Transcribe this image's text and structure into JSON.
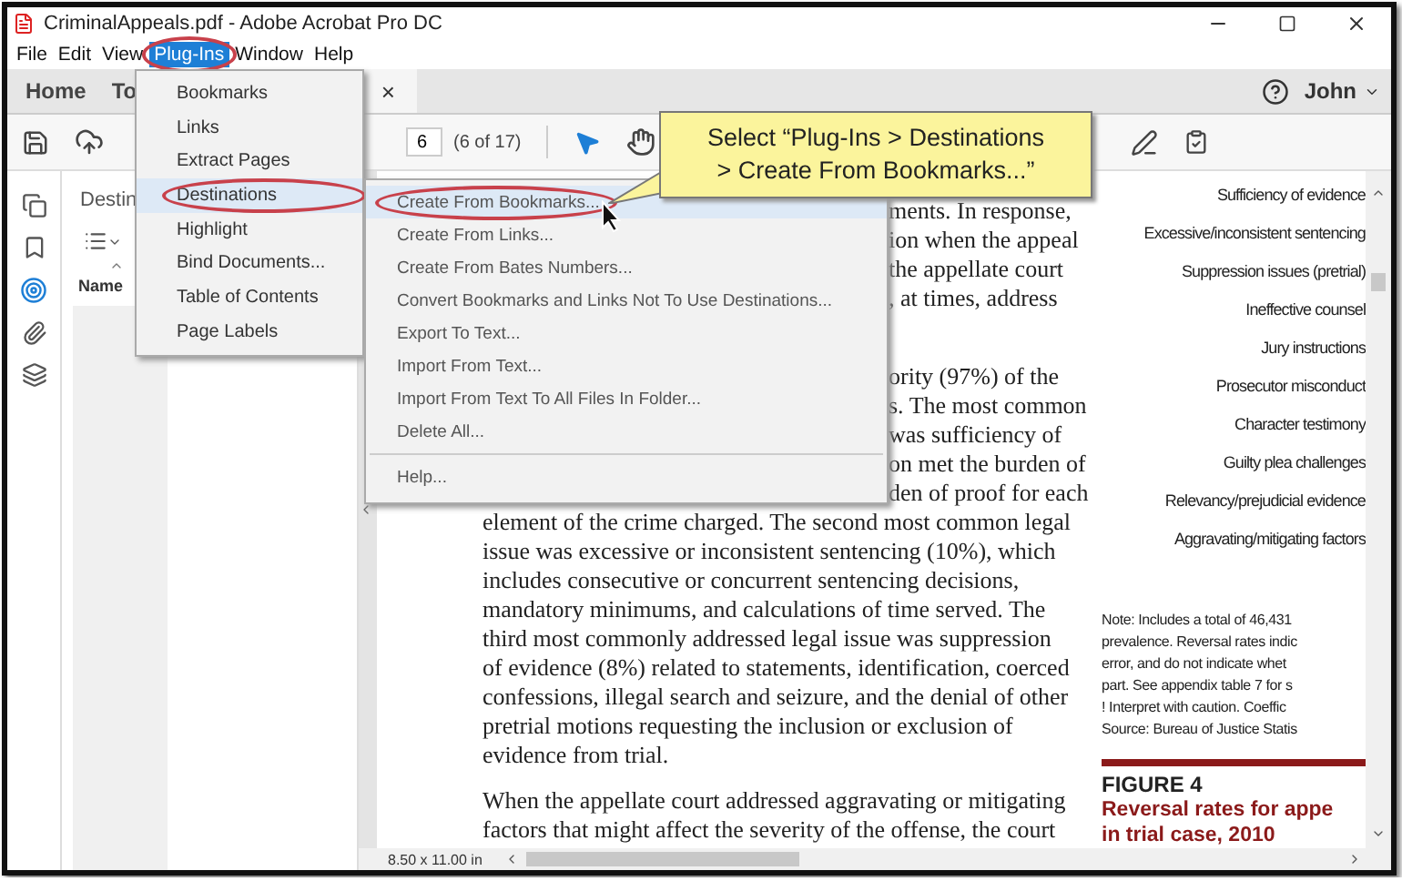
{
  "window": {
    "title": "CriminalAppeals.pdf - Adobe Acrobat Pro DC"
  },
  "menu_bar": [
    {
      "label": "File",
      "selected": false,
      "circled": false
    },
    {
      "label": "Edit",
      "selected": false,
      "circled": false
    },
    {
      "label": "View",
      "selected": false,
      "circled": false
    },
    {
      "label": "Plug-Ins",
      "selected": true,
      "circled": true
    },
    {
      "label": "Window",
      "selected": false,
      "circled": false
    },
    {
      "label": "Help",
      "selected": false,
      "circled": false
    }
  ],
  "tab_bar": {
    "tabs": [
      {
        "label": "Home"
      },
      {
        "label": "To"
      }
    ],
    "close": "×",
    "user": "John"
  },
  "toolbar": {
    "page_number": "6",
    "page_count": "(6 of 17)"
  },
  "side_tools": [
    {
      "kind": "pages",
      "selected": false
    },
    {
      "kind": "bookmarks",
      "selected": false
    },
    {
      "kind": "destinations",
      "selected": true
    },
    {
      "kind": "attachments",
      "selected": false
    },
    {
      "kind": "layers",
      "selected": false
    }
  ],
  "nav_panel": {
    "title": "Destin",
    "column": "Name"
  },
  "plugins_menu": [
    {
      "label": "Bookmarks",
      "selected": false,
      "circled": false
    },
    {
      "label": "Links",
      "selected": false,
      "circled": false
    },
    {
      "label": "Extract Pages",
      "selected": false,
      "circled": false
    },
    {
      "label": "Destinations",
      "selected": true,
      "circled": true
    },
    {
      "label": "Highlight",
      "selected": false,
      "circled": false
    },
    {
      "label": "Bind Documents...",
      "selected": false,
      "circled": false
    },
    {
      "label": "Table of Contents",
      "selected": false,
      "circled": false
    },
    {
      "label": "Page Labels",
      "selected": false,
      "circled": false
    }
  ],
  "destinations_submenu": [
    {
      "kind": "item",
      "label": "Create From Bookmarks...",
      "selected": true,
      "circled": true
    },
    {
      "kind": "item",
      "label": "Create From Links...",
      "selected": false,
      "circled": false
    },
    {
      "kind": "item",
      "label": "Create From Bates Numbers...",
      "selected": false,
      "circled": false
    },
    {
      "kind": "item",
      "label": "Convert Bookmarks and Links Not To Use Destinations...",
      "selected": false,
      "circled": false
    },
    {
      "kind": "item",
      "label": "Export To Text...",
      "selected": false,
      "circled": false
    },
    {
      "kind": "item",
      "label": "Import From Text...",
      "selected": false,
      "circled": false
    },
    {
      "kind": "item",
      "label": "Import From Text To All Files In Folder...",
      "selected": false,
      "circled": false
    },
    {
      "kind": "item",
      "label": "Delete All...",
      "selected": false,
      "circled": false
    },
    {
      "kind": "separator"
    },
    {
      "kind": "item",
      "label": "Help...",
      "selected": false,
      "circled": false
    }
  ],
  "callout": {
    "lines": [
      "Select “Plug-Ins > Destinations",
      "> Create From Bookmarks...”"
    ]
  },
  "document": {
    "paragraphs": [
      {
        "lines": [
          {
            "text": "ments. In response,",
            "partial": true
          },
          {
            "text": "ion when the appeal",
            "partial": true
          },
          {
            "text": "the appellate court",
            "partial": true
          },
          {
            "text": ", at times, address",
            "partial": true
          }
        ]
      },
      {
        "lines": [
          {
            "text": "ority (97%) of the",
            "partial": true
          },
          {
            "text": "s. The most common",
            "partial": true
          },
          {
            "text": "was sufficiency of",
            "partial": true
          },
          {
            "text": "on met the burden of",
            "partial": true
          },
          {
            "text": "den of proof for each",
            "partial": true
          },
          {
            "text": "element of the crime charged. The second most common legal",
            "partial": false
          },
          {
            "text": "issue was excessive or inconsistent sentencing (10%), which",
            "partial": false
          },
          {
            "text": "includes consecutive or concurrent sentencing decisions,",
            "partial": false
          },
          {
            "text": "mandatory minimums, and calculations of time served. The",
            "partial": false
          },
          {
            "text": "third most commonly addressed legal issue was suppression",
            "partial": false
          },
          {
            "text": "of evidence (8%) related to statements, identification, coerced",
            "partial": false
          },
          {
            "text": "confessions, illegal search and seizure, and the denial of other",
            "partial": false
          },
          {
            "text": "pretrial motions requesting the inclusion or exclusion of",
            "partial": false
          },
          {
            "text": "evidence from trial.",
            "partial": false
          }
        ]
      },
      {
        "lines": [
          {
            "text": "When the appellate court addressed aggravating or mitigating",
            "partial": false
          },
          {
            "text": "factors that might affect the severity of the offense, the court",
            "partial": false
          }
        ]
      }
    ],
    "chart_labels": [
      "Sufficiency of evidence",
      "Excessive/inconsistent sentencing",
      "Suppression issues (pretrial)",
      "Ineffective counsel",
      "Jury instructions",
      "Prosecutor misconduct",
      "Character testimony",
      "Guilty plea challenges",
      "Relevancy/prejudicial evidence",
      "Aggravating/mitigating factors"
    ],
    "note_lines": [
      "Note: Includes a total of 46,431",
      "prevalence. Reversal rates indic",
      "error, and do not indicate whet",
      "part. See appendix table 7 for s",
      "! Interpret with caution. Coeffic",
      "Source: Bureau of Justice Statis"
    ],
    "figure": {
      "label": "FIGURE 4",
      "title_lines": [
        "Reversal rates for appe",
        "in trial case, 2010"
      ]
    }
  },
  "status_bar": {
    "page_size": "8.50 x 11.00 in"
  }
}
